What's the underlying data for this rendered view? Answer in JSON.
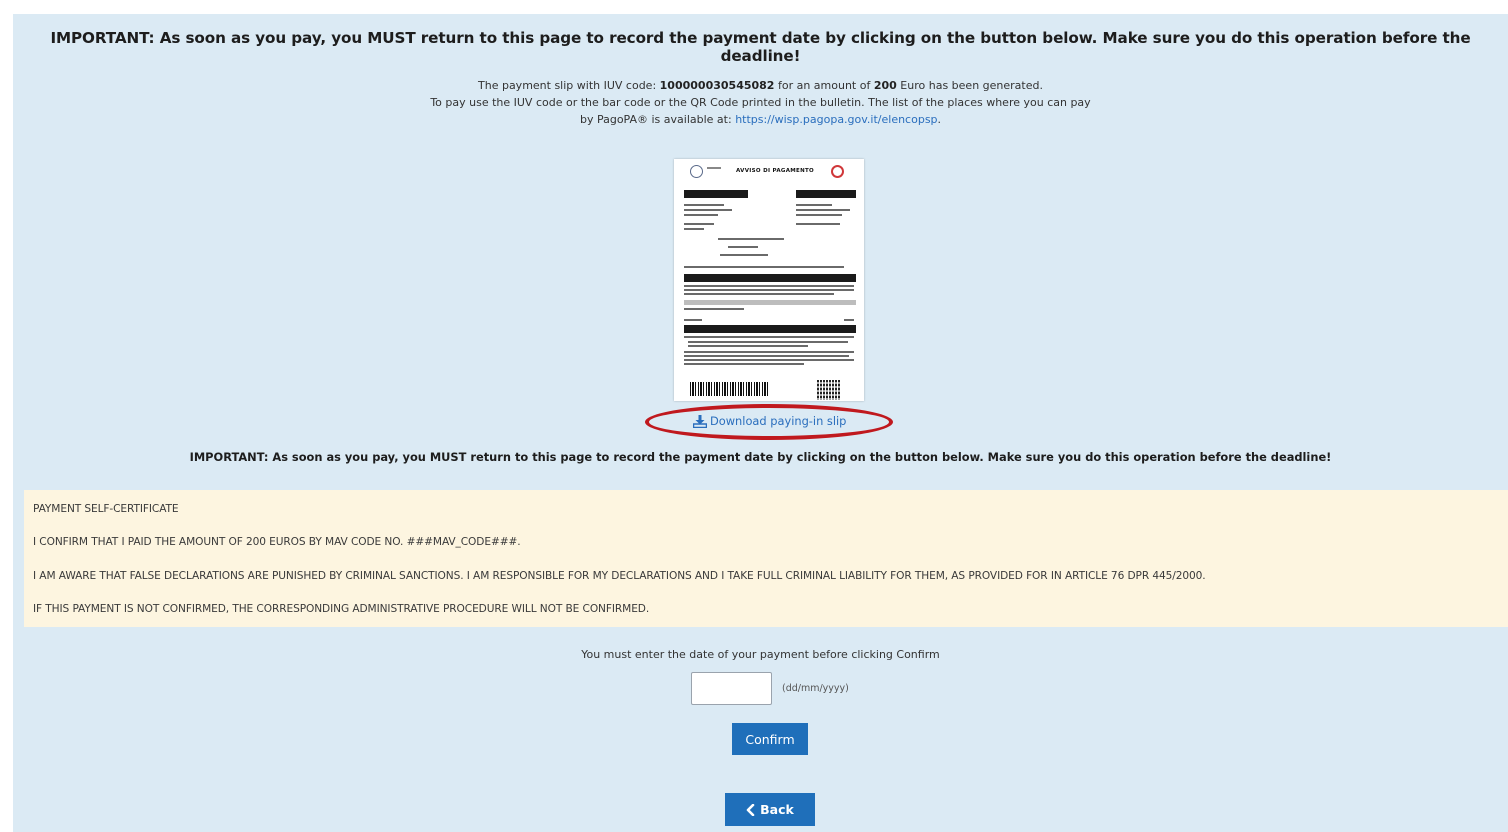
{
  "header": {
    "important_top": "IMPORTANT: As soon as you pay, you MUST return to this page to record the payment date by clicking on the button below. Make sure you do this operation before the deadline!",
    "important_mid": "IMPORTANT: As soon as you pay, you MUST return to this page to record the payment date by clicking on the button below. Make sure you do this operation before the deadline!"
  },
  "intro": {
    "line1_prefix": "The payment slip with IUV code: ",
    "iuv_code": "100000030545082",
    "line1_mid": " for an amount of ",
    "amount": "200",
    "line1_suffix": " Euro has been generated.",
    "line2": "To pay use the IUV code or the bar code or the QR Code printed in the bulletin. The list of the places where you can pay",
    "line3_prefix": "by PagoPA® is available at: ",
    "link": "https://wisp.pagopa.gov.it/elencopsp",
    "line3_suffix": "."
  },
  "slip_preview": {
    "title": "AVVISO DI PAGAMENTO",
    "highlight_color": "#c0191e"
  },
  "download": {
    "label": "Download paying-in slip",
    "icon": "download-icon"
  },
  "certificate": {
    "title": "PAYMENT SELF-CERTIFICATE",
    "line1": "I CONFIRM THAT I PAID THE AMOUNT OF 200 EUROS BY MAV CODE NO. ###MAV_CODE###.",
    "line2": "I AM AWARE THAT FALSE DECLARATIONS ARE PUNISHED BY CRIMINAL SANCTIONS. I AM RESPONSIBLE FOR MY DECLARATIONS AND I TAKE FULL CRIMINAL LIABILITY FOR THEM, AS PROVIDED FOR IN ARTICLE 76 DPR 445/2000.",
    "line3": "IF THIS PAYMENT IS NOT CONFIRMED, THE CORRESPONDING ADMINISTRATIVE PROCEDURE WILL NOT BE CONFIRMED."
  },
  "form": {
    "notice": "You must enter the date of your payment before clicking Confirm",
    "date_value": "",
    "date_hint": "(dd/mm/yyyy)",
    "confirm_label": "Confirm",
    "back_label": "Back",
    "back_icon": "chevron-left-icon"
  },
  "colors": {
    "panel_bg": "#dbeaf4",
    "certificate_bg": "#fdf5e0",
    "button_bg": "#1f6fba",
    "link": "#2a6ebd"
  }
}
